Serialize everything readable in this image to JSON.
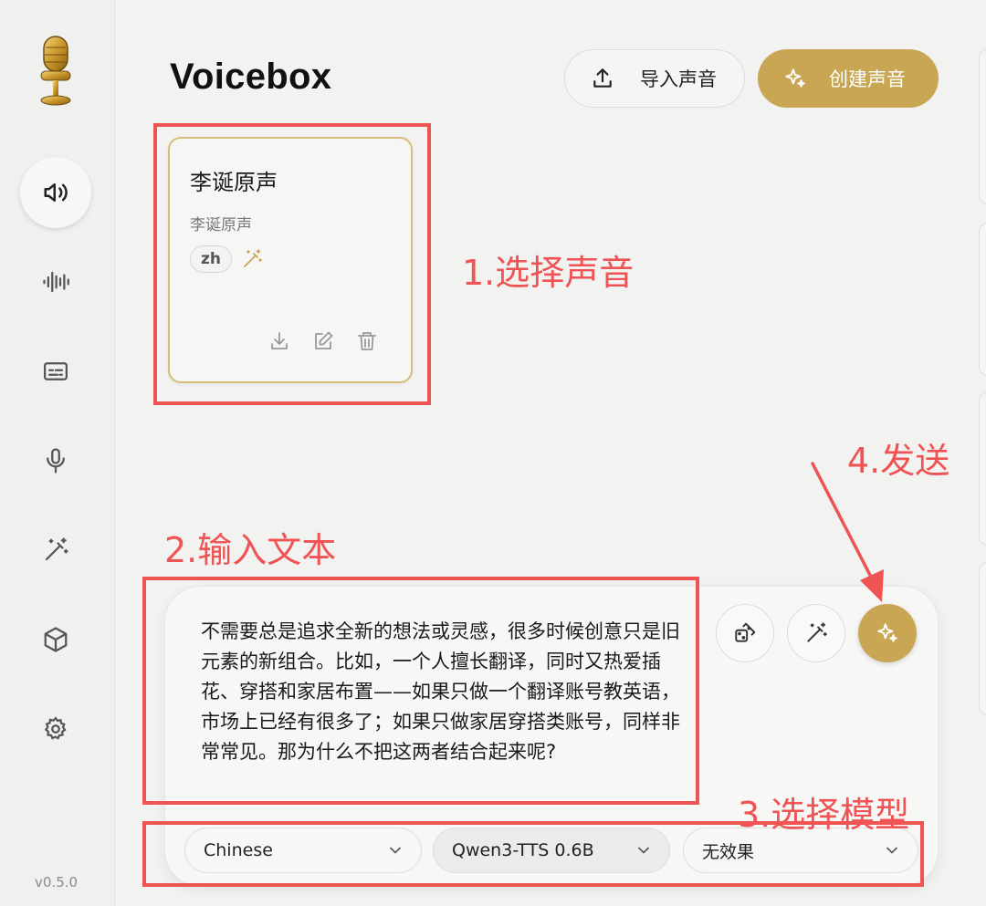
{
  "app": {
    "title": "Voicebox",
    "version": "v0.5.0"
  },
  "sidebar": {
    "items": [
      {
        "name": "voices",
        "icon": "speaker-icon",
        "active": true
      },
      {
        "name": "audio",
        "icon": "waveform-icon",
        "active": false
      },
      {
        "name": "captions",
        "icon": "captions-icon",
        "active": false
      },
      {
        "name": "record",
        "icon": "microphone-icon",
        "active": false
      },
      {
        "name": "effects",
        "icon": "magic-wand-icon",
        "active": false
      },
      {
        "name": "models",
        "icon": "cube-icon",
        "active": false
      },
      {
        "name": "settings",
        "icon": "gear-icon",
        "active": false
      }
    ]
  },
  "header": {
    "import_label": "导入声音",
    "create_label": "创建声音"
  },
  "voice_card": {
    "name": "李诞原声",
    "description": "李诞原声",
    "language": "zh"
  },
  "generator": {
    "text": "不需要总是追求全新的想法或灵感，很多时候创意只是旧元素的新组合。比如，一个人擅长翻译，同时又热爱插花、穿搭和家居布置——如果只做一个翻译账号教英语，市场上已经有很多了；如果只做家居穿搭类账号，同样非常常见。那为什么不把这两者结合起来呢?",
    "language_select": "Chinese",
    "model_select": "Qwen3-TTS 0.6B",
    "effect_select": "无效果"
  },
  "annotations": {
    "step1": "1.选择声音",
    "step2": "2.输入文本",
    "step3": "3.选择模型",
    "step4": "4.发送"
  },
  "colors": {
    "accent": "#c9a654",
    "annotation": "#ef5353",
    "background": "#f2f2f1"
  }
}
